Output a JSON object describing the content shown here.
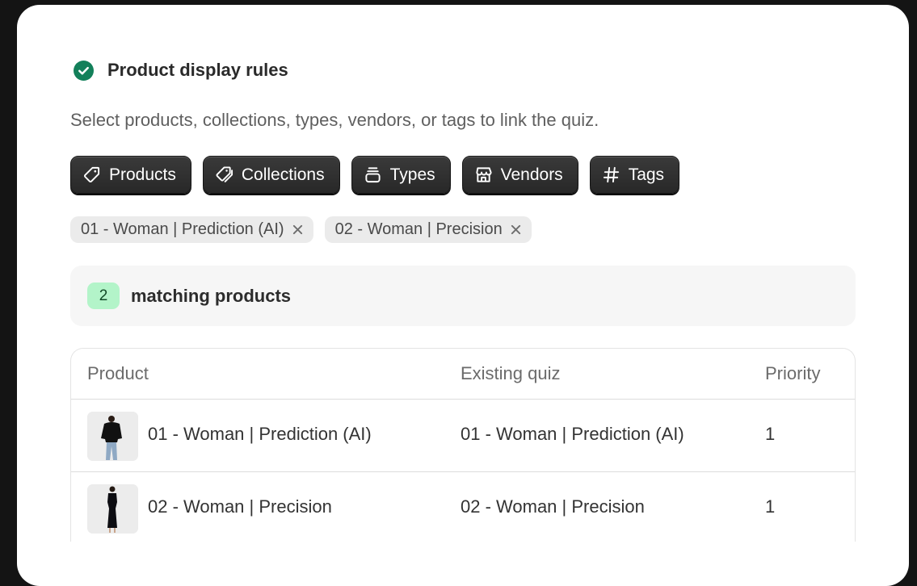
{
  "header": {
    "title": "Product display rules",
    "icon": "check-circle-icon",
    "icon_color": "#13805a"
  },
  "description": "Select products, collections, types, vendors, or tags to link the quiz.",
  "filters": [
    {
      "label": "Products",
      "icon": "tag-icon"
    },
    {
      "label": "Collections",
      "icon": "tags-icon"
    },
    {
      "label": "Types",
      "icon": "stack-icon"
    },
    {
      "label": "Vendors",
      "icon": "store-icon"
    },
    {
      "label": "Tags",
      "icon": "hash-icon"
    }
  ],
  "selected_chips": [
    {
      "label": "01 - Woman | Prediction (AI)"
    },
    {
      "label": "02 - Woman | Precision"
    }
  ],
  "matching": {
    "count": "2",
    "label": "matching products",
    "badge_color": "#b3f4c9"
  },
  "table": {
    "columns": [
      "Product",
      "Existing quiz",
      "Priority"
    ],
    "rows": [
      {
        "product": "01 - Woman | Prediction (AI)",
        "existing_quiz": "01 - Woman | Prediction (AI)",
        "priority": "1"
      },
      {
        "product": "02 - Woman | Precision",
        "existing_quiz": "02 - Woman | Precision",
        "priority": "1"
      }
    ]
  }
}
